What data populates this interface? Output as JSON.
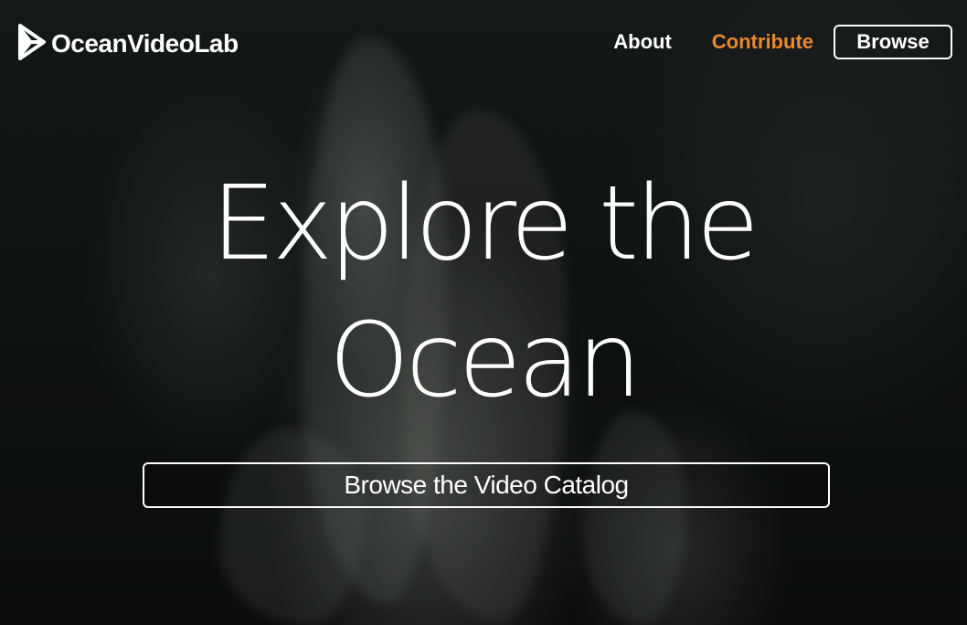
{
  "brand": {
    "name": "OceanVideoLab",
    "icon": "play-arrow-logo-icon"
  },
  "nav": {
    "about": "About",
    "contribute": "Contribute",
    "browse": "Browse"
  },
  "hero": {
    "headline_line1": "Explore the",
    "headline_line2": "Ocean",
    "cta_label": "Browse the Video Catalog"
  },
  "colors": {
    "accent": "#e8892c",
    "text": "#ffffff",
    "background": "#0f1212"
  }
}
